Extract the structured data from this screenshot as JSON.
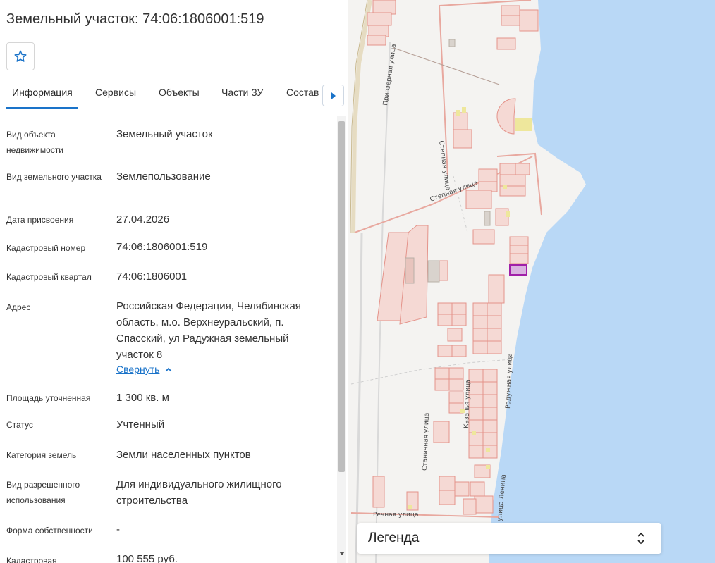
{
  "panel": {
    "title": "Земельный участок: 74:06:1806001:519",
    "tabs": [
      "Информация",
      "Сервисы",
      "Объекты",
      "Части ЗУ",
      "Состав"
    ],
    "active_tab": "Информация",
    "rows": [
      {
        "label": "Вид объекта недвижимости",
        "value": "Земельный участок"
      },
      {
        "label": "Вид земельного участка",
        "value": "Землепользование"
      },
      {
        "label": "Дата присвоения",
        "value": "27.04.2026"
      },
      {
        "label": "Кадастровый номер",
        "value": "74:06:1806001:519"
      },
      {
        "label": "Кадастровый квартал",
        "value": "74:06:1806001"
      },
      {
        "label": "Адрес",
        "value": "Российская Федерация, Челябинская область, м.о. Верхнеуральский, п. Спасский, ул Радужная земельный участок 8"
      },
      {
        "label": "Площадь уточненная",
        "value": "1 300 кв. м"
      },
      {
        "label": "Статус",
        "value": "Учтенный"
      },
      {
        "label": "Категория земель",
        "value": "Земли населенных пунктов"
      },
      {
        "label": "Вид разрешенного использования",
        "value": "Для индивидуального жилищного строительства"
      },
      {
        "label": "Форма собственности",
        "value": "-"
      },
      {
        "label": "Кадастровая",
        "value": "100 555 руб."
      }
    ],
    "collapse_label": "Свернуть"
  },
  "map": {
    "streets": [
      "Приозерная улица",
      "Степная улица",
      "Степная улица",
      "Казачья улица",
      "Радужная улица",
      "Станичная улица",
      "улица Ленина",
      "Речная улица"
    ],
    "legend_title": "Легенда",
    "colors": {
      "water": "#b9d8f6",
      "land": "#f4f3f1",
      "parcel_fill": "#f5d9d4",
      "parcel_stroke": "#e4938a",
      "selected_fill": "#d9b3e0",
      "selected_stroke": "#a020a8"
    }
  }
}
